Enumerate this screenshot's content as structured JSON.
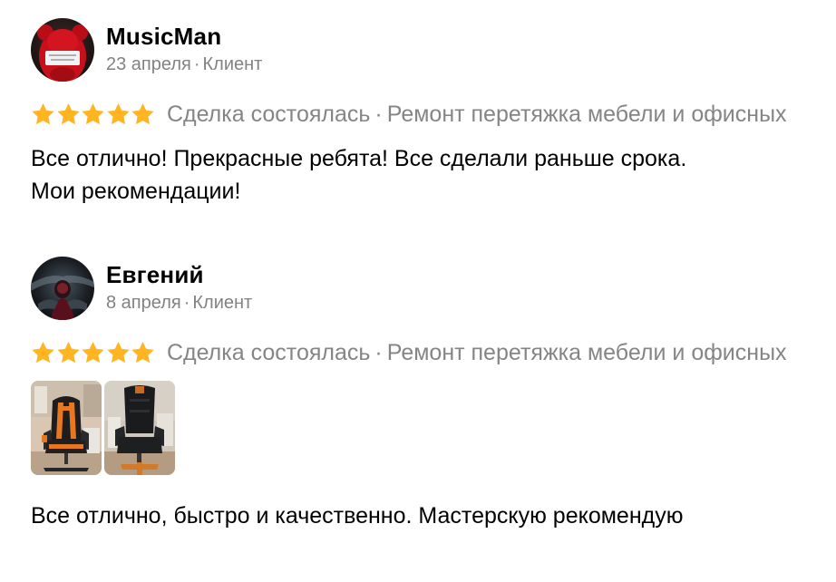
{
  "reviews": [
    {
      "author": "MusicMan",
      "date": "23 апреля",
      "role": "Клиент",
      "rating": 5,
      "deal_status": "Сделка состоялась",
      "service": "Ремонт перетяжка мебели и офисных",
      "text_lines": [
        "Все отлично! Прекрасные ребята! Все сделали раньше срока.",
        "Мои рекомендации!"
      ]
    },
    {
      "author": "Евгений",
      "date": "8 апреля",
      "role": "Клиент",
      "rating": 5,
      "deal_status": "Сделка состоялась",
      "service": "Ремонт перетяжка мебели и офисных",
      "photo_count": 2,
      "text_lines": [
        "Все отлично, быстро и качественно. Мастерскую рекомендую"
      ]
    }
  ],
  "separator": "·",
  "colors": {
    "star": "#FFB521",
    "secondary_text": "#828282",
    "primary_text": "#000000"
  }
}
